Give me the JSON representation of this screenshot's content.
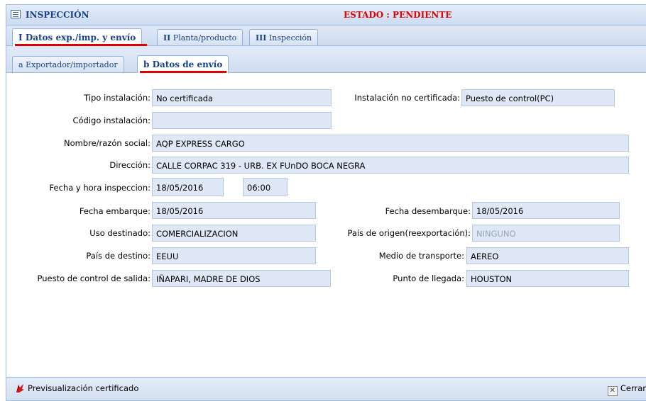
{
  "window": {
    "title": "INSPECCIÓN",
    "status": "ESTADO : PENDIENTE"
  },
  "main_tabs": [
    {
      "roman": "I",
      "label": "Datos exp./imp. y envío"
    },
    {
      "roman": "II",
      "label": "Planta/producto"
    },
    {
      "roman": "III",
      "label": "Inspección"
    }
  ],
  "sub_tabs": [
    {
      "letter": "a",
      "label": "Exportador/importador"
    },
    {
      "letter": "b",
      "label": "Datos de envío"
    }
  ],
  "form": {
    "tipo_instalacion": {
      "label": "Tipo instalación:",
      "value": "No certificada"
    },
    "instalacion_no_certificada": {
      "label": "Instalación no certificada:",
      "value": "Puesto de control(PC)"
    },
    "codigo_instalacion": {
      "label": "Código instalación:",
      "value": ""
    },
    "nombre_razon_social": {
      "label": "Nombre/razón social:",
      "value": "AQP EXPRESS CARGO"
    },
    "direccion": {
      "label": "Dirección:",
      "value": "CALLE CORPAC 319 - URB. EX FUnDO BOCA NEGRA"
    },
    "fecha_hora_inspeccion": {
      "label": "Fecha y hora inspeccion:",
      "date": "18/05/2016",
      "time": "06:00"
    },
    "fecha_embarque": {
      "label": "Fecha embarque:",
      "value": "18/05/2016"
    },
    "fecha_desembarque": {
      "label": "Fecha desembarque:",
      "value": "18/05/2016"
    },
    "uso_destinado": {
      "label": "Uso destinado:",
      "value": "COMERCIALIZACION"
    },
    "pais_origen": {
      "label": "País de origen(reexportación):",
      "value": "NINGUNO"
    },
    "pais_destino": {
      "label": "País de destino:",
      "value": "EEUU"
    },
    "medio_transporte": {
      "label": "Medio de transporte:",
      "value": "AEREO"
    },
    "puesto_control_salida": {
      "label": "Puesto de control de salida:",
      "value": "IÑAPARI, MADRE DE DIOS"
    },
    "punto_llegada": {
      "label": "Punto de llegada:",
      "value": "HOUSTON"
    }
  },
  "footer": {
    "preview_label": "Previsualización certificado",
    "close_label": "Cerrar"
  },
  "colors": {
    "accent": "#15428b",
    "status": "#e00000",
    "field_bg": "#dfe8f6"
  }
}
